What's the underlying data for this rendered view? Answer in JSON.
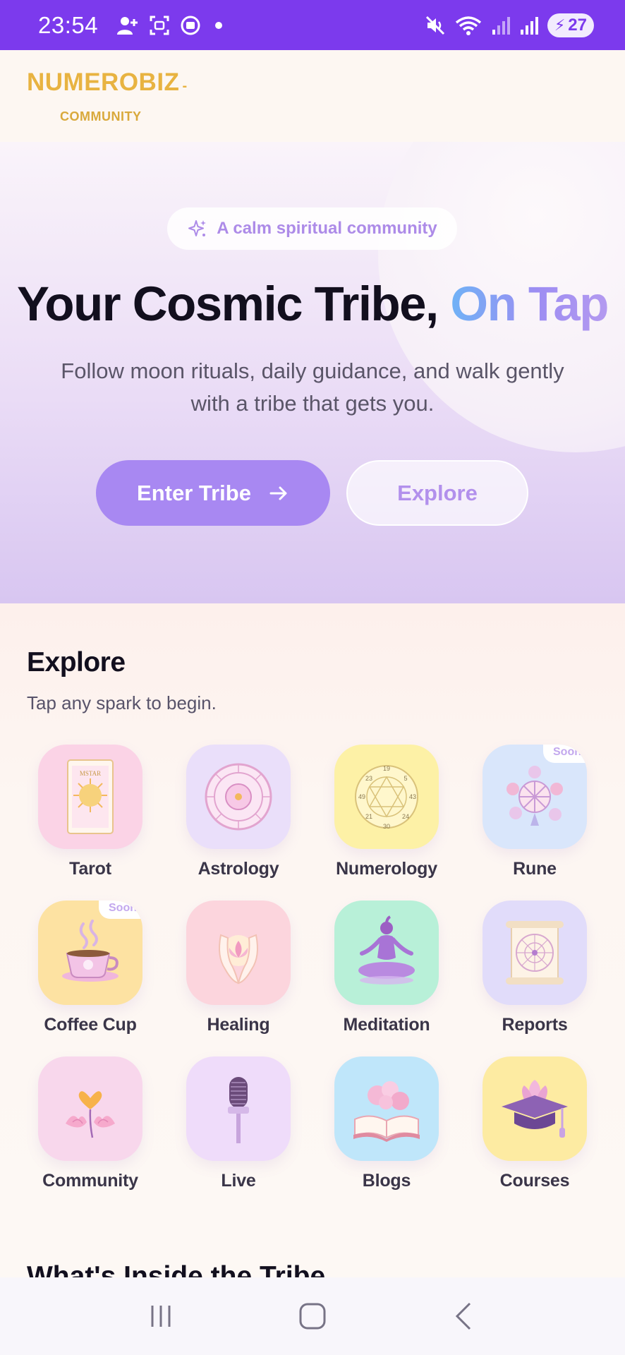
{
  "status_bar": {
    "time": "23:54",
    "battery": "27",
    "icons": [
      "person-add-icon",
      "screenshot-icon",
      "screen-record-icon",
      "dot-icon",
      "mute-icon",
      "wifi-icon",
      "signal-icon",
      "signal-icon",
      "battery-icon"
    ]
  },
  "header": {
    "logo": "NUMEROBIZ",
    "logo_sub": "COMMUNITY"
  },
  "hero": {
    "pill_text": "A calm spiritual community",
    "title_main": "Your Cosmic Tribe, ",
    "title_accent": "On Tap",
    "subtitle": "Follow moon rituals, daily guidance, and walk gently with a tribe that gets you.",
    "primary_button": "Enter Tribe",
    "secondary_button": "Explore"
  },
  "explore": {
    "title": "Explore",
    "subtitle": "Tap any spark to begin.",
    "items": [
      {
        "label": "Tarot",
        "icon": "tarot-card-icon",
        "bg": "#fbd3e6"
      },
      {
        "label": "Astrology",
        "icon": "zodiac-wheel-icon",
        "bg": "#eadffa"
      },
      {
        "label": "Numerology",
        "icon": "numerology-wheel-icon",
        "bg": "#fdf1a6"
      },
      {
        "label": "Rune",
        "icon": "rune-stones-icon",
        "bg": "#d9e6fb",
        "badge": "Soon"
      },
      {
        "label": "Coffee Cup",
        "icon": "coffee-cup-icon",
        "bg": "#fde2a2",
        "badge": "Soon"
      },
      {
        "label": "Healing",
        "icon": "healing-hands-icon",
        "bg": "#fcd5dd"
      },
      {
        "label": "Meditation",
        "icon": "meditation-icon",
        "bg": "#b8f0d8"
      },
      {
        "label": "Reports",
        "icon": "scroll-chart-icon",
        "bg": "#e1dcfa"
      },
      {
        "label": "Community",
        "icon": "lotus-heart-icon",
        "bg": "#f8d7ec"
      },
      {
        "label": "Live",
        "icon": "microphone-icon",
        "bg": "#efdcfa"
      },
      {
        "label": "Blogs",
        "icon": "open-book-icon",
        "bg": "#bfe6fa"
      },
      {
        "label": "Courses",
        "icon": "graduation-cap-icon",
        "bg": "#fdeba2"
      }
    ]
  },
  "next_section": {
    "title": "What's Inside the Tribe"
  },
  "navbar": {
    "icons": [
      "recent-apps-icon",
      "home-icon",
      "back-icon"
    ]
  }
}
